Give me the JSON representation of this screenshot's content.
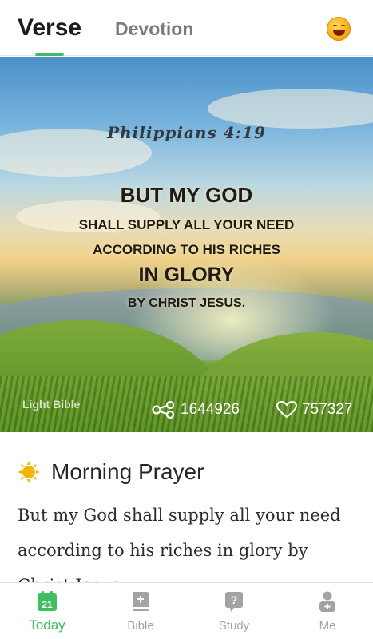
{
  "header": {
    "tabs": [
      {
        "label": "Verse",
        "active": true
      },
      {
        "label": "Devotion",
        "active": false
      }
    ],
    "emoji_icon": "laughing-face-icon"
  },
  "verse_card": {
    "reference": "Philippians 4:19",
    "lines": [
      "BUT MY GOD",
      "SHALL SUPPLY ALL YOUR NEED",
      "ACCORDING TO HIS RICHES",
      "IN GLORY",
      "BY CHRIST JESUS."
    ],
    "watermark": "Light Bible",
    "share_count": "1644926",
    "like_count": "757327"
  },
  "prayer": {
    "title": "Morning Prayer",
    "body": "But my God shall supply all your need according to his riches in glory by Christ Jesus."
  },
  "bottom_nav": {
    "items": [
      {
        "label": "Today",
        "icon": "calendar-icon",
        "badge": "21",
        "active": true
      },
      {
        "label": "Bible",
        "icon": "book-icon",
        "active": false
      },
      {
        "label": "Study",
        "icon": "question-icon",
        "active": false
      },
      {
        "label": "Me",
        "icon": "person-icon",
        "active": false
      }
    ]
  },
  "colors": {
    "accent": "#3fbf62",
    "inactive": "#a3a3a3"
  }
}
